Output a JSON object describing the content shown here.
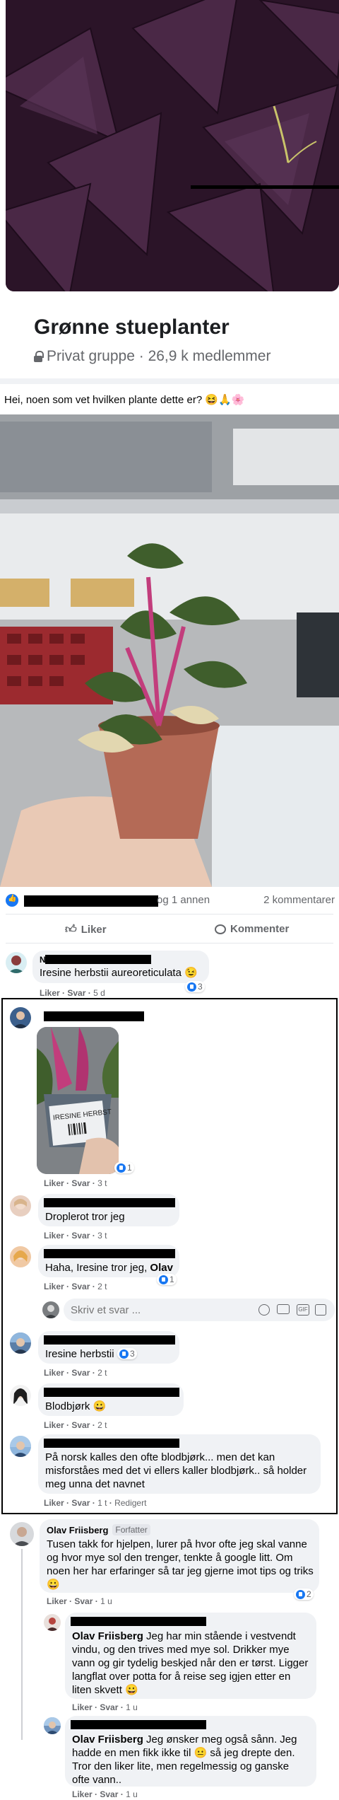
{
  "group": {
    "title": "Grønne stueplanter",
    "subtitle": "Privat gruppe · 26,9 k medlemmer"
  },
  "post": {
    "text": "Hei, noen som vet hvilken plante dette er? 😆🙏🌸",
    "reactions_text": "og 1 annen",
    "comments_count": "2 kommentarer",
    "like_label": "Liker",
    "comment_label": "Kommenter"
  },
  "comments": [
    {
      "initial": "N",
      "text": "Iresine herbstii aureoreticulata 😉",
      "like": "Liker",
      "reply": "Svar",
      "time": "5 d",
      "reactions": "3"
    },
    {
      "like": "Liker",
      "reply": "Svar",
      "time": "3 t",
      "reactions": "1",
      "photo_label": "IRESINE HERBST"
    },
    {
      "text": "Droplerot tror jeg",
      "like": "Liker",
      "reply": "Svar",
      "time": "3 t"
    },
    {
      "text_before": "Haha, Iresine tror jeg, ",
      "text_bold": "Olav",
      "like": "Liker",
      "reply": "Svar",
      "time": "2 t",
      "reactions": "1"
    },
    {
      "text": "Iresine herbstii",
      "like": "Liker",
      "reply": "Svar",
      "time": "2 t",
      "reactions": "3"
    },
    {
      "text": "Blodbjørk 😀",
      "like": "Liker",
      "reply": "Svar",
      "time": "2 t"
    },
    {
      "text": "På norsk kalles den ofte blodbjørk... men det kan misforståes med det vi ellers kaller blodbjørk.. så holder meg unna det navnet",
      "like": "Liker",
      "reply": "Svar",
      "time": "1 t",
      "edited": "Redigert"
    },
    {
      "author": "Olav Friisberg",
      "badge": "Forfatter",
      "text": "Tusen takk for hjelpen, lurer på hvor ofte jeg skal vanne og hvor mye sol den trenger, tenkte å google litt. Om noen her har erfaringer så tar jeg gjerne imot tips og triks 😀",
      "like": "Liker",
      "reply": "Svar",
      "time": "1 u",
      "reactions": "2"
    },
    {
      "mention": "Olav Friisberg",
      "text": " Jeg har min stående i vestvendt vindu, og den trives med mye sol. Drikker mye vann og gir tydelig beskjed når den er tørst. Ligger langflat over potta for å reise seg igjen etter en liten skvett 😀",
      "like": "Liker",
      "reply": "Svar",
      "time": "1 u"
    },
    {
      "mention": "Olav Friisberg",
      "text": " Jeg ønsker meg også sånn. Jeg hadde en men fikk ikke til 😐 så jeg drepte den. Tror den liker lite, men regelmessig og ganske ofte vann..",
      "like": "Liker",
      "reply": "Svar",
      "time": "1 u"
    }
  ],
  "reply_box": {
    "placeholder": "Skriv et svar ..."
  },
  "colors": {
    "accent": "#1877f2",
    "bubble": "#f0f2f5",
    "muted": "#65676b",
    "purple": "#3a1f36"
  }
}
